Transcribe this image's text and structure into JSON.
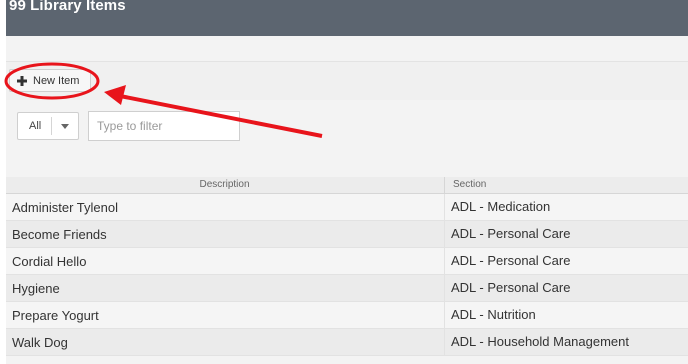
{
  "header": {
    "title": "99 Library Items"
  },
  "toolbar": {
    "new_item_label": "New Item"
  },
  "filter": {
    "scope_value": "All",
    "placeholder": "Type to filter"
  },
  "table": {
    "columns": [
      "Description",
      "Section"
    ],
    "rows": [
      {
        "description": "Administer Tylenol",
        "section": "ADL - Medication"
      },
      {
        "description": "Become Friends",
        "section": "ADL - Personal Care"
      },
      {
        "description": "Cordial Hello",
        "section": "ADL - Personal Care"
      },
      {
        "description": "Hygiene",
        "section": "ADL - Personal Care"
      },
      {
        "description": "Prepare Yogurt",
        "section": "ADL - Nutrition"
      },
      {
        "description": "Walk Dog",
        "section": "ADL - Household Management"
      }
    ]
  },
  "annotation": {
    "color": "#e8141b"
  },
  "icons": {
    "new_item": "plus-icon",
    "scope_dropdown": "caret-down-icon"
  }
}
